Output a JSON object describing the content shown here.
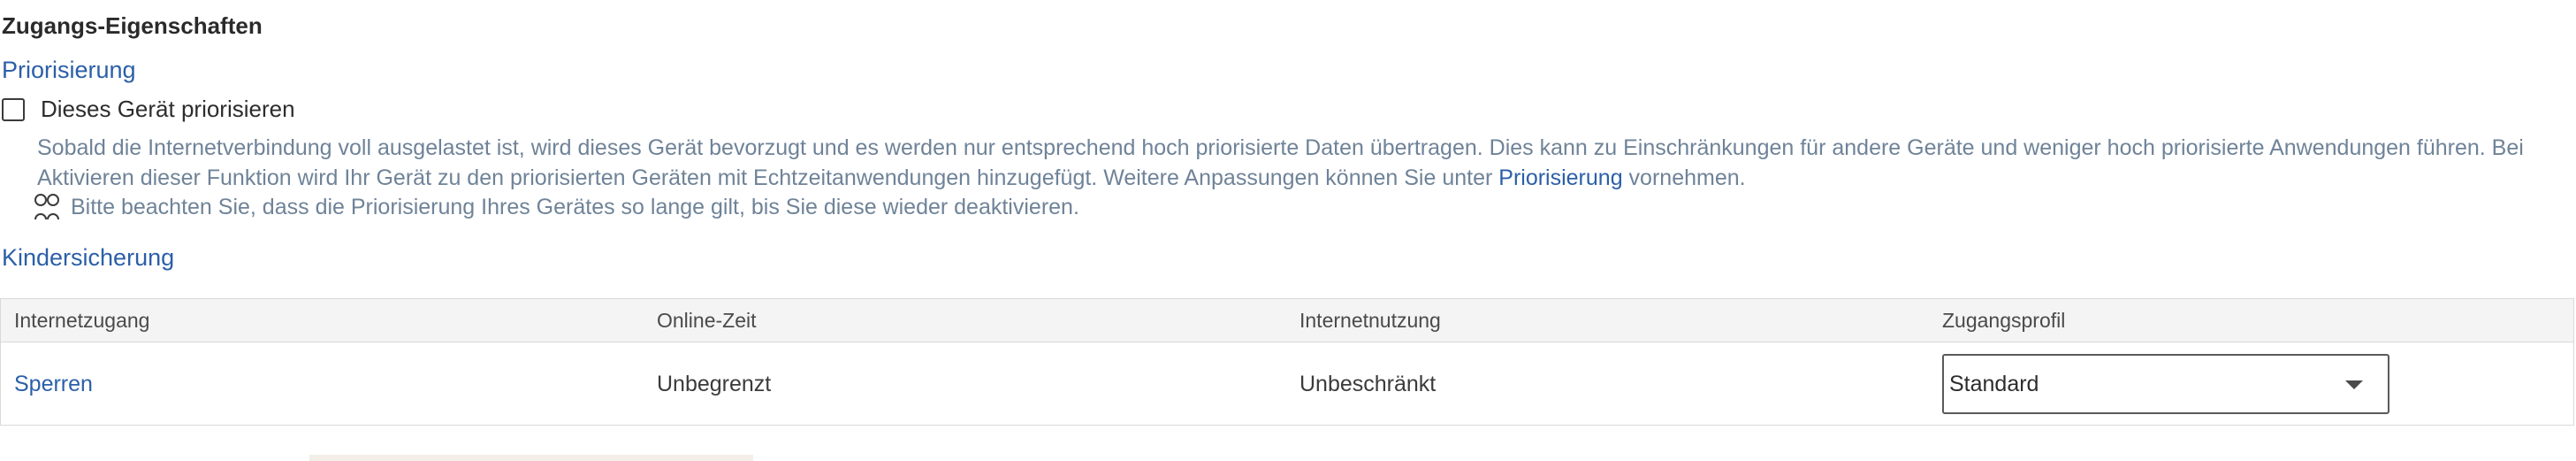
{
  "section": {
    "title": "Zugangs-Eigenschaften"
  },
  "prioritization": {
    "heading": "Priorisierung",
    "checkbox_label": "Dieses Gerät priorisieren",
    "checked": false,
    "description_line1": "Sobald die Internetverbindung voll ausgelastet ist, wird dieses Gerät bevorzugt und es werden nur entsprechend hoch priorisierte Daten übertragen. Dies kann zu Einschränkungen für andere Geräte und weniger hoch priorisierte Anwendungen führen. Bei",
    "description_line2_before_link": "Aktivieren dieser Funktion wird Ihr Gerät zu den priorisierten Geräten mit Echtzeitanwendungen hinzugefügt. Weitere Anpassungen können Sie unter ",
    "description_link": "Priorisierung",
    "description_line2_after_link": " vornehmen.",
    "note_icon": "info-icon",
    "note": "Bitte beachten Sie, dass die Priorisierung Ihres Gerätes so lange gilt, bis Sie diese wieder deaktivieren."
  },
  "parental_control": {
    "heading": "Kindersicherung",
    "columns": [
      "Internetzugang",
      "Online-Zeit",
      "Internetnutzung",
      "Zugangsprofil"
    ],
    "row": {
      "internet_access": "Sperren",
      "online_time": "Unbegrenzt",
      "internet_usage": "Unbeschränkt",
      "access_profile": "Standard"
    }
  },
  "colors": {
    "link": "#2b5fa8",
    "muted_text": "#6f8398",
    "header_bg": "#f4f4f4"
  }
}
